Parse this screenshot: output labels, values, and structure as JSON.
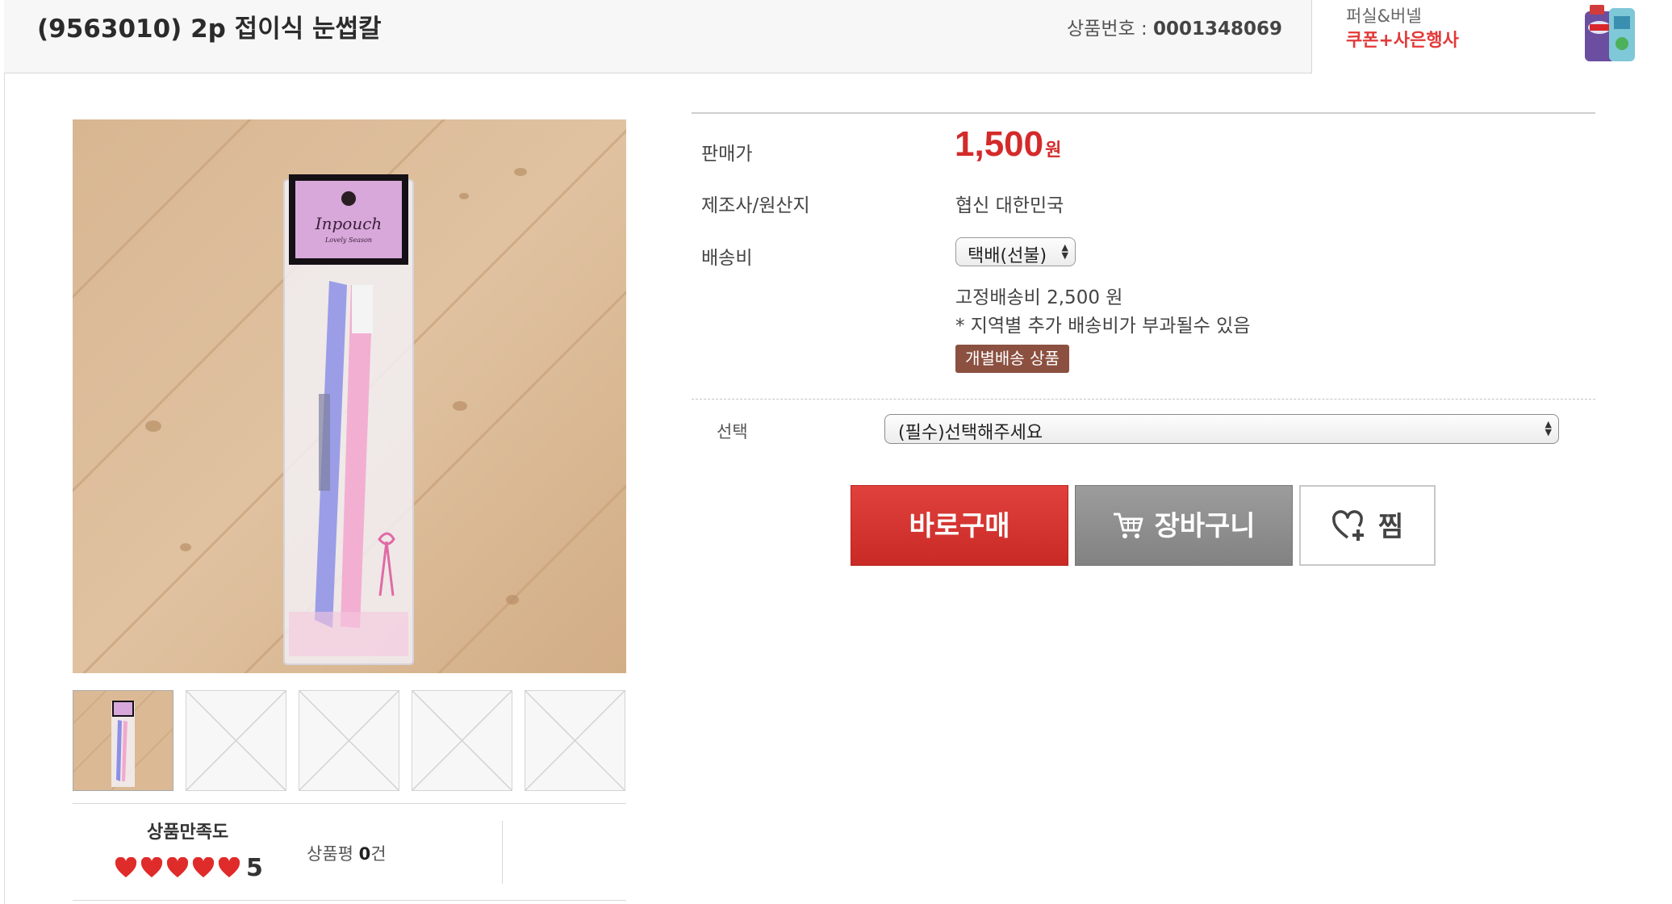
{
  "header": {
    "title": "(9563010) 2p 접이식 눈썹칼",
    "product_number_label": "상품번호 :",
    "product_number": "0001348069"
  },
  "ad": {
    "line1": "퍼실&버넬",
    "line2": "쿠폰+사은행사",
    "icon": "detergent-bottles-image"
  },
  "gallery": {
    "package_brand": "Inpouch",
    "package_subbrand": "Lovely Season",
    "thumbnail_count": 5,
    "placeholder_icon": "no-image-x-icon"
  },
  "rating": {
    "label": "상품만족도",
    "stars_filled": 5,
    "value": "5",
    "review_label": "상품평",
    "review_count": "0",
    "review_unit": "건",
    "heart_color": "#e02b2b"
  },
  "info": {
    "price_label": "판매가",
    "price": "1,500",
    "price_unit": "원",
    "maker_label": "제조사/원산지",
    "maker_value": "협신 대한민국",
    "shipping_label": "배송비",
    "shipping_method": "택배(선불)",
    "fixed_fee": "고정배송비 2,500 원",
    "fee_note": "* 지역별 추가 배송비가 부과될수 있음",
    "badge": "개별배송 상품",
    "option_label": "선택",
    "option_placeholder": "(필수)선택해주세요"
  },
  "actions": {
    "buy_label": "바로구매",
    "cart_label": "장바구니",
    "wish_label": "찜",
    "buy_color": "#d6332f",
    "cart_color": "#8e8e8e"
  }
}
